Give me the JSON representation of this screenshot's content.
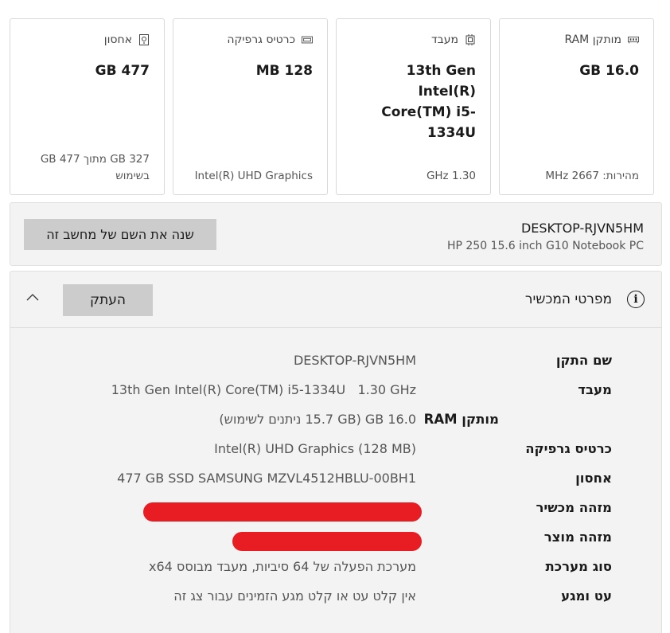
{
  "cards": [
    {
      "title": "מותקן RAM",
      "icon": "ram-icon",
      "value": "16.0 GB",
      "sub": "מהירות: 2667 MHz"
    },
    {
      "title": "מעבד",
      "icon": "cpu-icon",
      "value": "13th Gen Intel(R) Core(TM) i5-1334U",
      "sub": "1.30 GHz"
    },
    {
      "title": "כרטיס גרפיקה",
      "icon": "gpu-icon",
      "value": "128 MB",
      "sub": "Intel(R) UHD Graphics"
    },
    {
      "title": "אחסון",
      "icon": "storage-icon",
      "value": "477 GB",
      "sub": "327 GB מתוך 477 GB בשימוש"
    }
  ],
  "device": {
    "name": "DESKTOP-RJVN5HM",
    "model": "HP 250 15.6 inch G10 Notebook PC",
    "rename_label": "שנה את השם של מחשב זה"
  },
  "specs": {
    "title": "מפרטי המכשיר",
    "copy_label": "העתק",
    "rows": [
      {
        "label": "שם התקן",
        "value": "DESKTOP-RJVN5HM"
      },
      {
        "label": "מעבד",
        "value": "13th Gen Intel(R) Core(TM) i5-1334U   1.30 GHz"
      },
      {
        "label": "מותקן RAM",
        "value": "16.0 GB (15.7 GB ניתנים לשימוש)"
      },
      {
        "label": "כרטיס גרפיקה",
        "value": "Intel(R) UHD Graphics (128 MB)"
      },
      {
        "label": "אחסון",
        "value": "477 GB SSD SAMSUNG MZVL4512HBLU-00BH1"
      },
      {
        "label": "מזהה מכשיר",
        "value": ""
      },
      {
        "label": "מזהה מוצר",
        "value": ""
      },
      {
        "label": "סוג מערכת",
        "value": "מערכת הפעלה של 64 סיביות, מעבד מבוסס x64"
      },
      {
        "label": "עט ומגע",
        "value": "אין קלט עט או קלט מגע הזמינים עבור צג זה"
      }
    ]
  },
  "colors": {
    "redaction": "#e81c23",
    "button": "#cccccc",
    "panel": "#f3f3f3"
  }
}
